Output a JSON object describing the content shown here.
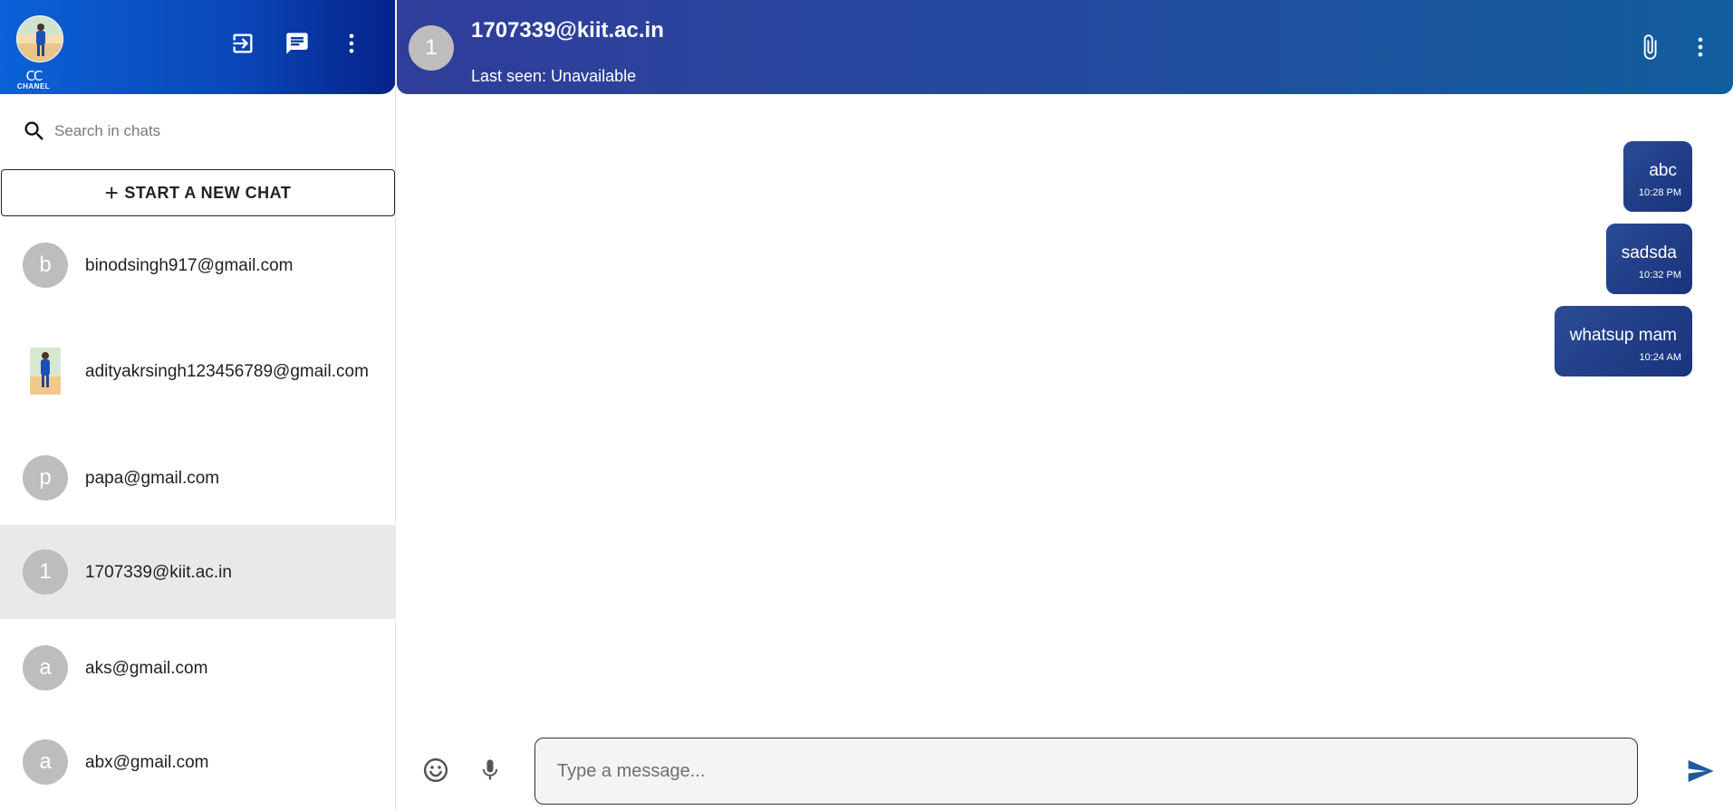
{
  "sidebar": {
    "brand": {
      "mark": "CC",
      "word": "CHANEL"
    },
    "search": {
      "placeholder": "Search in chats",
      "value": ""
    },
    "new_chat_label": "START A NEW CHAT",
    "chats": [
      {
        "initial": "b",
        "name": "binodsingh917@gmail.com",
        "has_photo": false,
        "active": false
      },
      {
        "initial": "",
        "name": "adityakrsingh123456789@gmail.com",
        "has_photo": true,
        "active": false
      },
      {
        "initial": "p",
        "name": "papa@gmail.com",
        "has_photo": false,
        "active": false
      },
      {
        "initial": "1",
        "name": "1707339@kiit.ac.in",
        "has_photo": false,
        "active": true
      },
      {
        "initial": "a",
        "name": "aks@gmail.com",
        "has_photo": false,
        "active": false
      },
      {
        "initial": "a",
        "name": "abx@gmail.com",
        "has_photo": false,
        "active": false
      }
    ]
  },
  "chat": {
    "header": {
      "initial": "1",
      "name": "1707339@kiit.ac.in",
      "status": "Last seen: Unavailable"
    },
    "messages": [
      {
        "text": "abc",
        "time": "10:28 PM"
      },
      {
        "text": "sadsda",
        "time": "10:32 PM"
      },
      {
        "text": "whatsup mam",
        "time": "10:24 AM"
      }
    ],
    "composer": {
      "placeholder": "Type a message...",
      "value": ""
    }
  },
  "colors": {
    "sidebar_header": "#0a47b8",
    "chat_header": "#244a9f",
    "bubble": "#1f3c85",
    "active_chat": "#e9e9eb",
    "send_icon": "#1d5a9e"
  },
  "icons": {
    "logout": "logout-icon",
    "new_chat": "chat-icon",
    "more": "more-vert-icon",
    "search": "search-icon",
    "attach": "paperclip-icon",
    "emoji": "emoji-icon",
    "mic": "mic-icon",
    "send": "send-icon"
  }
}
